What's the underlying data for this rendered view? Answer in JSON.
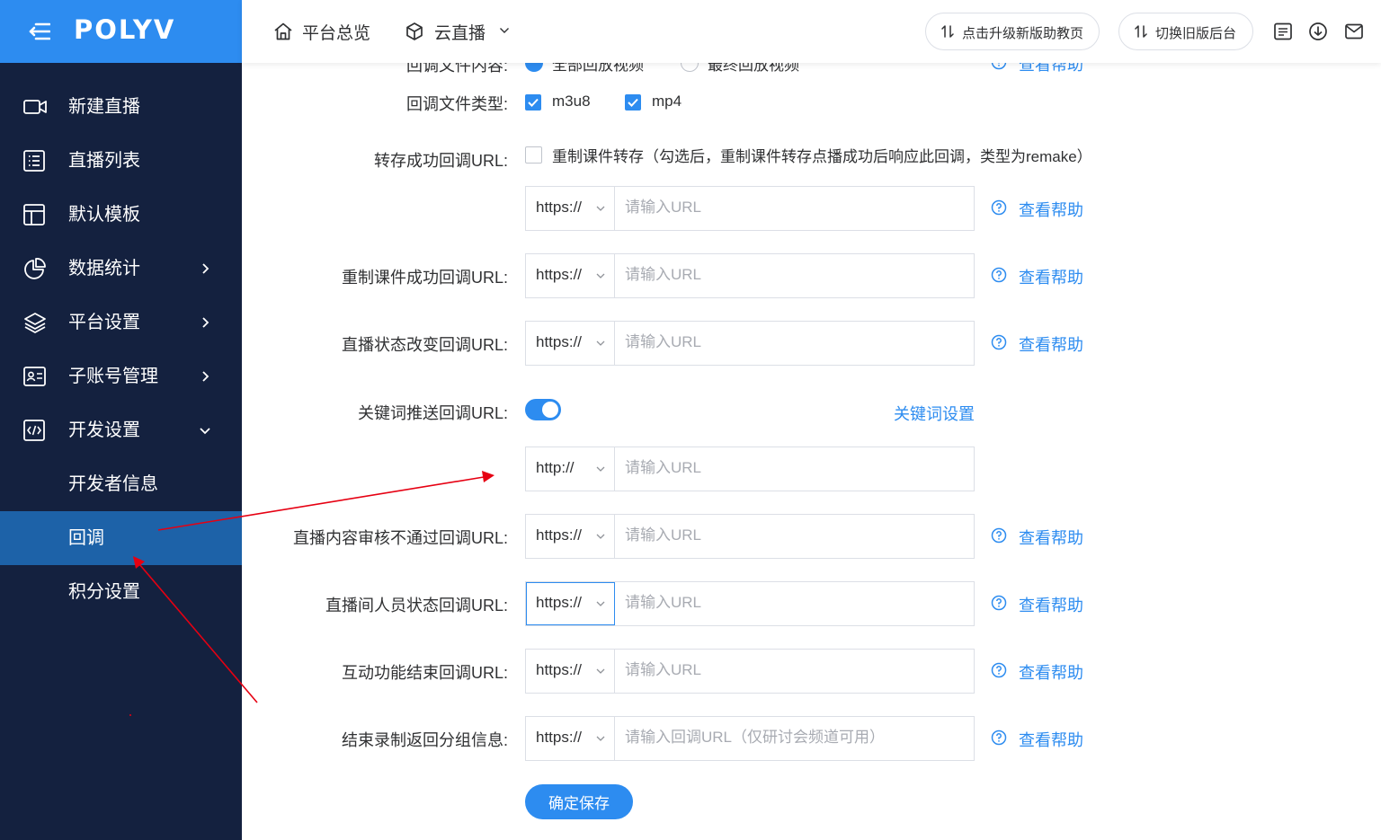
{
  "brand": {
    "logo_text": "POLYV"
  },
  "sidebar": {
    "items": [
      {
        "label": "新建直播"
      },
      {
        "label": "直播列表"
      },
      {
        "label": "默认模板"
      },
      {
        "label": "数据统计"
      },
      {
        "label": "平台设置"
      },
      {
        "label": "子账号管理"
      },
      {
        "label": "开发设置"
      }
    ],
    "sub_items": [
      {
        "label": "开发者信息"
      },
      {
        "label": "回调"
      },
      {
        "label": "积分设置"
      }
    ]
  },
  "topbar": {
    "home_label": "平台总览",
    "cloud_live_label": "云直播",
    "upgrade_button": "点击升级新版助教页",
    "switch_button": "切换旧版后台"
  },
  "form": {
    "partial_row": {
      "label": "回调文件内容:",
      "option1": "全部回放视频",
      "option2": "最终回放视频"
    },
    "file_type": {
      "label": "回调文件类型:",
      "opt_m3u8": "m3u8",
      "opt_mp4": "mp4"
    },
    "transfer": {
      "label": "转存成功回调URL:",
      "remake_text": "重制课件转存（勾选后，重制课件转存点播成功后响应此回调，类型为remake）"
    },
    "url_placeholder": "请输入URL",
    "url_placeholder_group": "请输入回调URL（仅研讨会频道可用）",
    "help_label": "查看帮助",
    "rows": [
      {
        "label": "",
        "protocol": "https://"
      },
      {
        "label": "重制课件成功回调URL:",
        "protocol": "https://"
      },
      {
        "label": "直播状态改变回调URL:",
        "protocol": "https://"
      },
      {
        "label": "",
        "protocol": "http://"
      },
      {
        "label": "直播内容审核不通过回调URL:",
        "protocol": "https://"
      },
      {
        "label": "直播间人员状态回调URL:",
        "protocol": "https://"
      },
      {
        "label": "互动功能结束回调URL:",
        "protocol": "https://"
      },
      {
        "label": "结束录制返回分组信息:",
        "protocol": "https://"
      }
    ],
    "keyword": {
      "label": "关键词推送回调URL:",
      "link": "关键词设置",
      "enabled": true
    },
    "save_button": "确定保存"
  },
  "colors": {
    "sidebar_bg": "#14213f",
    "accent": "#2d8cf0",
    "active_item": "#1d62a8",
    "annotation_arrow": "#e60012"
  }
}
